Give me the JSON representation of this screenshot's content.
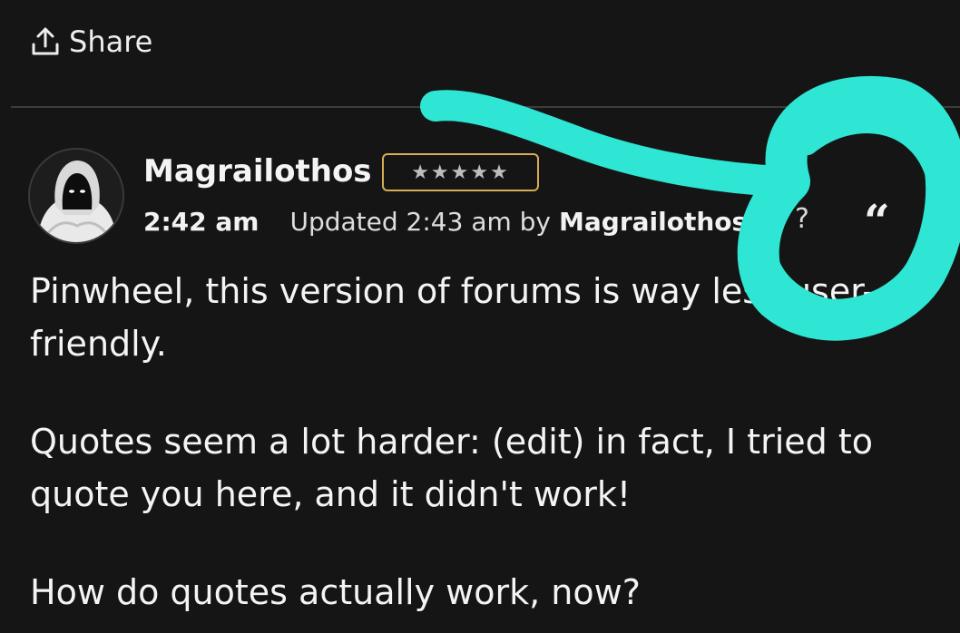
{
  "toolbar": {
    "share_label": "Share",
    "share_icon": "upload-arrow-icon"
  },
  "post": {
    "author": "Magrailothos",
    "rank_badge": "★★★★★",
    "posted_time": "2:42 am",
    "updated_text": "Updated 2:43 am by",
    "updated_by": "Magrailothos",
    "flag_glyph": "?",
    "quote_glyph": "“",
    "body": [
      "Pinwheel, this version of forums is way less user-friendly.",
      "Quotes seem a lot harder: (edit) in fact, I tried to quote you here, and it didn't work!",
      "How do quotes actually work, now?"
    ]
  },
  "colors": {
    "background": "#151515",
    "badge_border": "#d6ae52",
    "annotation": "#2fe6d4"
  }
}
